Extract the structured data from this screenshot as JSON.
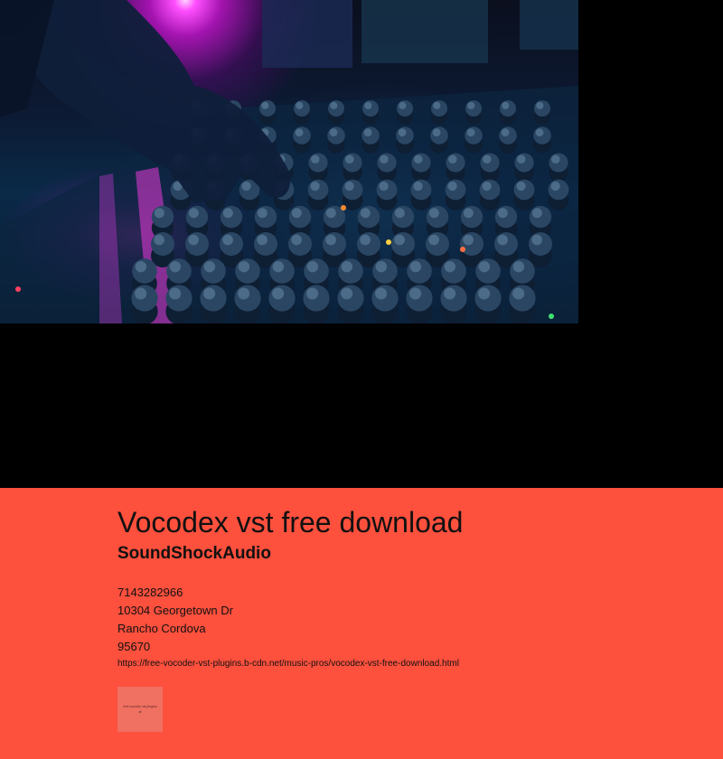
{
  "hero": {
    "image_alt": "dj-mixing-console-photo"
  },
  "info": {
    "title": "Vocodex vst free download",
    "subtitle": "SoundShockAudio",
    "phone": "7143282966",
    "street": "10304 Georgetown Dr",
    "city": "Rancho Cordova",
    "zip": "95670",
    "url": "https://free-vocoder-vst-plugins.b-cdn.net/music-pros/vocodex-vst-free-download.html",
    "thumbnail_line1": "free vocoder vst plugins",
    "thumbnail_line2": "xl"
  },
  "colors": {
    "background": "#000000",
    "info_panel": "#fd503d",
    "text": "#111111"
  }
}
